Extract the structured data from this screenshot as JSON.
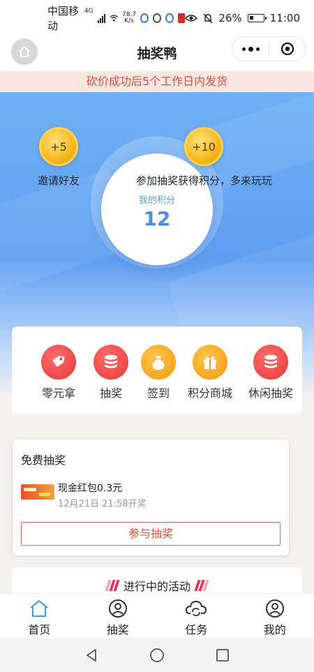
{
  "status_bar": {
    "carrier": "中国移动",
    "network": "4G",
    "speed_value": "78.7",
    "speed_unit": "K/s",
    "battery": "26%",
    "time": "11:00"
  },
  "nav": {
    "title": "抽奖鸭"
  },
  "notice": {
    "text": "砍价成功后5个工作日内发货"
  },
  "hero": {
    "coin_left": "+5",
    "coin_left_label": "邀请好友",
    "coin_right": "+10",
    "coin_right_label": "参加抽奖获得积分，多来玩玩",
    "score_label": "我的积分",
    "score_value": "12"
  },
  "shortcuts": [
    {
      "label": "零元拿",
      "icon": "tag-icon",
      "color": "#e73a3a"
    },
    {
      "label": "抽奖",
      "icon": "coin-stack-icon",
      "color": "#e73a3a"
    },
    {
      "label": "签到",
      "icon": "money-bag-icon",
      "color": "#f39a12"
    },
    {
      "label": "积分商城",
      "icon": "gift-icon",
      "color": "#f39a12"
    },
    {
      "label": "休闲抽奖",
      "icon": "coin-stack-icon",
      "color": "#e73a3a"
    }
  ],
  "free_lottery": {
    "title": "免费抽奖",
    "prize_name": "现金红包0.3元",
    "prize_time": "12月21日 21:58开奖",
    "join_label": "参与抽奖"
  },
  "activities": {
    "title": "进行中的活动"
  },
  "tab_bar": {
    "active_color": "#3fa0d8",
    "tabs": [
      {
        "label": "首页",
        "icon": "home-icon",
        "active": true
      },
      {
        "label": "抽奖",
        "icon": "user-circle-icon",
        "active": false
      },
      {
        "label": "任务",
        "icon": "cloud-refresh-icon",
        "active": false
      },
      {
        "label": "我的",
        "icon": "profile-icon",
        "active": false
      }
    ]
  }
}
